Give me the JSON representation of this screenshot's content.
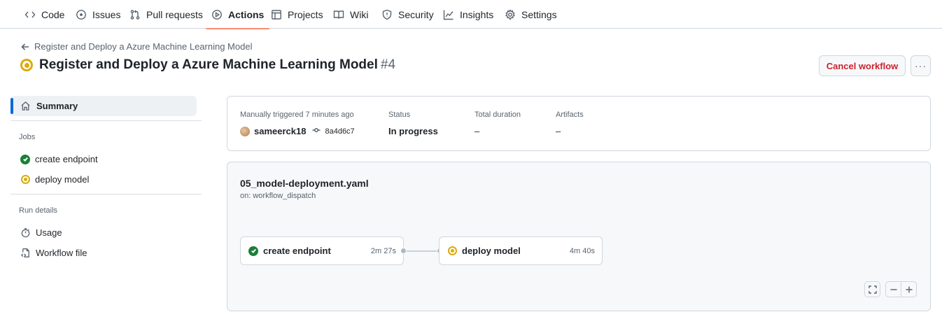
{
  "nav": {
    "items": [
      {
        "label": "Code",
        "icon": "code-icon"
      },
      {
        "label": "Issues",
        "icon": "issue-icon"
      },
      {
        "label": "Pull requests",
        "icon": "pull-request-icon"
      },
      {
        "label": "Actions",
        "icon": "play-icon",
        "active": true
      },
      {
        "label": "Projects",
        "icon": "table-icon"
      },
      {
        "label": "Wiki",
        "icon": "book-icon"
      },
      {
        "label": "Security",
        "icon": "shield-icon"
      },
      {
        "label": "Insights",
        "icon": "graph-icon"
      },
      {
        "label": "Settings",
        "icon": "gear-icon"
      }
    ]
  },
  "header": {
    "breadcrumb": "Register and Deploy a Azure Machine Learning Model",
    "title": "Register and Deploy a Azure Machine Learning Model",
    "run_number": "#4",
    "status": "in-progress",
    "cancel_label": "Cancel workflow",
    "more_label": "···"
  },
  "sidebar": {
    "summary_label": "Summary",
    "jobs_heading": "Jobs",
    "jobs": [
      {
        "label": "create endpoint",
        "status": "success"
      },
      {
        "label": "deploy model",
        "status": "in-progress"
      }
    ],
    "run_details_heading": "Run details",
    "run_details": [
      {
        "label": "Usage",
        "icon": "stopwatch-icon"
      },
      {
        "label": "Workflow file",
        "icon": "file-code-icon"
      }
    ]
  },
  "summary": {
    "trigger_label": "Manually triggered 7 minutes ago",
    "actor": "sameerck18",
    "commit_sha": "8a4d6c7",
    "status_label": "Status",
    "status_value": "In progress",
    "duration_label": "Total duration",
    "duration_value": "–",
    "artifacts_label": "Artifacts",
    "artifacts_value": "–"
  },
  "graph": {
    "workflow_file": "05_model-deployment.yaml",
    "trigger": "on: workflow_dispatch",
    "jobs": [
      {
        "name": "create endpoint",
        "duration": "2m 27s",
        "status": "success"
      },
      {
        "name": "deploy model",
        "duration": "4m 40s",
        "status": "in-progress"
      }
    ],
    "controls": [
      "fullscreen-icon",
      "zoom-out-icon",
      "zoom-in-icon"
    ]
  },
  "colors": {
    "accent_underline": "#fd8c73",
    "success": "#1a7f37",
    "in_progress": "#dbab0a",
    "danger": "#cf222e",
    "selected_bar": "#0969da"
  }
}
